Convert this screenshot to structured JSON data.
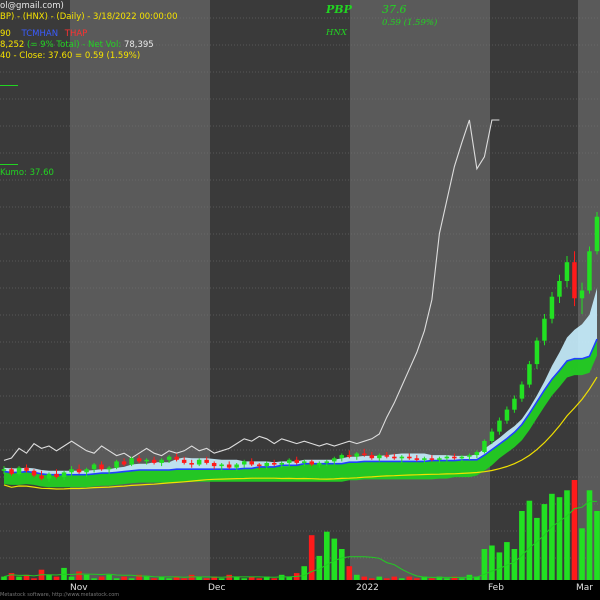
{
  "header": {
    "email_fragment": "ol@gmail.com)",
    "title_line": "BP) - (HNX) - (Daily) - 3/18/2022 00:00:00",
    "line2_prefix": "90",
    "line2_blue": "TCMHAN",
    "line2_red": "THAP",
    "line3_a": "8,252",
    "line3_b": "(= 9% Total)",
    "line3_c": "-  Net Vol:",
    "line3_d": "78,395",
    "line4_prefix": "40",
    "line4_close": "-  Close: 37.60 = 0.59 (1.59%)",
    "kumo_label": "Kumo: 37.60"
  },
  "ticker": {
    "symbol": "PBP",
    "price": "37.6",
    "exchange": "HNX",
    "change": "0.59 (1.59%)"
  },
  "x_axis_labels": [
    "Nov",
    "Dec",
    "2022",
    "Feb",
    "Mar"
  ],
  "watermark": "Metastock software, http://www.metastock.com",
  "colors": {
    "up_candle": "#22e022",
    "down_candle": "#ff1a1a",
    "cloud_light": "#c8f0ff",
    "cloud_green": "#22cc22",
    "yellow_line": "#f0e000",
    "blue_line": "#2040ff",
    "white_line": "#dddddd"
  },
  "chart_data": {
    "type": "candlestick",
    "candles": [
      [
        36.5,
        36.8,
        36.3,
        36.6
      ],
      [
        36.6,
        36.7,
        36.2,
        36.3
      ],
      [
        36.3,
        36.8,
        36.2,
        36.7
      ],
      [
        36.7,
        36.9,
        36.4,
        36.5
      ],
      [
        36.5,
        36.6,
        36.1,
        36.2
      ],
      [
        36.2,
        36.5,
        35.9,
        36.0
      ],
      [
        36.0,
        36.4,
        35.8,
        36.3
      ],
      [
        36.3,
        36.6,
        36.0,
        36.1
      ],
      [
        36.1,
        36.5,
        35.9,
        36.4
      ],
      [
        36.4,
        36.8,
        36.2,
        36.6
      ],
      [
        36.6,
        36.9,
        36.3,
        36.4
      ],
      [
        36.4,
        36.7,
        36.1,
        36.6
      ],
      [
        36.6,
        37.0,
        36.4,
        36.9
      ],
      [
        36.9,
        37.1,
        36.5,
        36.6
      ],
      [
        36.6,
        36.8,
        36.3,
        36.7
      ],
      [
        36.7,
        37.2,
        36.6,
        37.1
      ],
      [
        37.1,
        37.3,
        36.8,
        36.9
      ],
      [
        36.9,
        37.4,
        36.8,
        37.3
      ],
      [
        37.3,
        37.5,
        37.0,
        37.1
      ],
      [
        37.1,
        37.3,
        36.9,
        37.2
      ],
      [
        37.2,
        37.4,
        36.9,
        37.0
      ],
      [
        37.0,
        37.3,
        36.8,
        37.2
      ],
      [
        37.2,
        37.5,
        37.0,
        37.4
      ],
      [
        37.4,
        37.6,
        37.1,
        37.2
      ],
      [
        37.2,
        37.4,
        36.9,
        37.0
      ],
      [
        37.0,
        37.2,
        36.7,
        36.9
      ],
      [
        36.9,
        37.3,
        36.8,
        37.2
      ],
      [
        37.2,
        37.4,
        36.9,
        37.0
      ],
      [
        37.0,
        37.1,
        36.6,
        36.8
      ],
      [
        36.8,
        37.0,
        36.5,
        36.9
      ],
      [
        36.9,
        37.1,
        36.6,
        36.7
      ],
      [
        36.7,
        37.0,
        36.5,
        36.9
      ],
      [
        36.9,
        37.2,
        36.7,
        37.1
      ],
      [
        37.1,
        37.3,
        36.8,
        36.9
      ],
      [
        36.9,
        37.0,
        36.6,
        36.8
      ],
      [
        36.8,
        37.1,
        36.6,
        37.0
      ],
      [
        37.0,
        37.2,
        36.8,
        36.9
      ],
      [
        36.9,
        37.1,
        36.7,
        37.0
      ],
      [
        37.0,
        37.3,
        36.8,
        37.2
      ],
      [
        37.2,
        37.4,
        36.9,
        37.0
      ],
      [
        37.0,
        37.2,
        36.8,
        37.1
      ],
      [
        37.1,
        37.2,
        36.8,
        36.9
      ],
      [
        36.9,
        37.1,
        36.7,
        37.0
      ],
      [
        37.0,
        37.2,
        36.8,
        37.1
      ],
      [
        37.1,
        37.4,
        36.9,
        37.3
      ],
      [
        37.3,
        37.6,
        37.1,
        37.5
      ],
      [
        37.5,
        37.8,
        37.3,
        37.4
      ],
      [
        37.4,
        37.7,
        37.2,
        37.6
      ],
      [
        37.6,
        37.9,
        37.4,
        37.5
      ],
      [
        37.5,
        37.7,
        37.2,
        37.3
      ],
      [
        37.3,
        37.6,
        37.1,
        37.5
      ],
      [
        37.5,
        37.7,
        37.3,
        37.4
      ],
      [
        37.4,
        37.6,
        37.2,
        37.3
      ],
      [
        37.3,
        37.5,
        37.0,
        37.4
      ],
      [
        37.4,
        37.6,
        37.2,
        37.3
      ],
      [
        37.3,
        37.5,
        37.1,
        37.2
      ],
      [
        37.2,
        37.4,
        37.0,
        37.3
      ],
      [
        37.3,
        37.5,
        37.1,
        37.2
      ],
      [
        37.2,
        37.4,
        37.0,
        37.3
      ],
      [
        37.3,
        37.5,
        37.1,
        37.4
      ],
      [
        37.4,
        37.6,
        37.2,
        37.3
      ],
      [
        37.3,
        37.5,
        37.1,
        37.4
      ],
      [
        37.4,
        37.6,
        37.2,
        37.5
      ],
      [
        37.5,
        37.8,
        37.3,
        37.7
      ],
      [
        37.7,
        38.5,
        37.6,
        38.4
      ],
      [
        38.4,
        39.2,
        38.2,
        39.0
      ],
      [
        39.0,
        39.9,
        38.8,
        39.7
      ],
      [
        39.7,
        40.6,
        39.5,
        40.4
      ],
      [
        40.4,
        41.3,
        40.2,
        41.1
      ],
      [
        41.1,
        42.2,
        40.9,
        42.0
      ],
      [
        42.0,
        43.5,
        41.8,
        43.3
      ],
      [
        43.3,
        45.0,
        43.0,
        44.8
      ],
      [
        44.8,
        46.5,
        44.5,
        46.2
      ],
      [
        46.2,
        47.9,
        45.9,
        47.6
      ],
      [
        47.6,
        49.0,
        47.2,
        48.6
      ],
      [
        48.6,
        50.2,
        48.2,
        49.8
      ],
      [
        49.8,
        50.5,
        47.0,
        47.5
      ],
      [
        47.5,
        48.5,
        46.5,
        48.0
      ],
      [
        48.0,
        50.8,
        47.8,
        50.5
      ],
      [
        50.5,
        53.0,
        50.3,
        52.7
      ]
    ],
    "volume": [
      2,
      4,
      2,
      3,
      1,
      6,
      3,
      2,
      7,
      2,
      5,
      3,
      1,
      2,
      3,
      1,
      2,
      1,
      3,
      2,
      1,
      2,
      1,
      2,
      1,
      3,
      2,
      1,
      2,
      1,
      3,
      2,
      1,
      2,
      1,
      2,
      1,
      3,
      2,
      4,
      8,
      26,
      14,
      28,
      24,
      18,
      8,
      3,
      2,
      1,
      2,
      1,
      2,
      1,
      2,
      1,
      2,
      1,
      2,
      1,
      2,
      1,
      3,
      2,
      18,
      20,
      16,
      22,
      18,
      40,
      46,
      36,
      44,
      50,
      48,
      52,
      58,
      30,
      52,
      40
    ],
    "ichimoku_base": 37.6,
    "ylim": [
      34,
      56
    ]
  }
}
